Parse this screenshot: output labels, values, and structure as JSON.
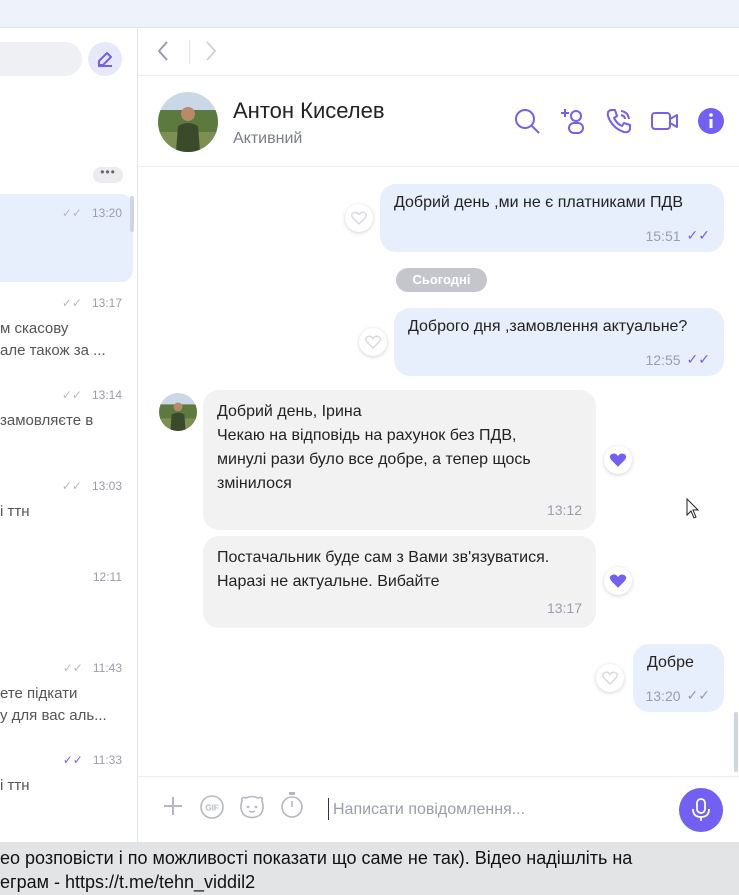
{
  "colors": {
    "accent": "#7360f2",
    "outgoing_bubble": "#e8effc",
    "incoming_bubble": "#f2f2f3",
    "read_check": "#7360f2"
  },
  "left_panel": {
    "more_label": "•••",
    "chats": [
      {
        "time": "13:20",
        "check": "✓✓",
        "line1": "",
        "line2": ""
      },
      {
        "time": "13:17",
        "check": "✓✓",
        "line1": "м скасову",
        "line2": "але також за ..."
      },
      {
        "time": "13:14",
        "check": "✓✓",
        "line1": "замовляєте в",
        "line2": ""
      },
      {
        "time": "13:03",
        "check": "✓✓",
        "line1": "і ттн",
        "line2": ""
      },
      {
        "time": "12:11",
        "check": "",
        "line1": "",
        "line2": ""
      },
      {
        "time": "11:43",
        "check": "✓✓",
        "line1": "ете підкати",
        "line2": "у для вас аль..."
      },
      {
        "time": "11:33",
        "check": "✓✓",
        "line1": "і ттн",
        "line2": ""
      }
    ]
  },
  "header": {
    "name": "Антон Киселев",
    "status": "Активний"
  },
  "messages": {
    "date_chip": "Сьогодні",
    "m1": {
      "text": "Добрий день ,ми не є платниками ПДВ",
      "time": "15:51",
      "check": "✓✓"
    },
    "m2": {
      "text": "Доброго дня ,замовлення актуальне?",
      "time": "12:55",
      "check": "✓✓"
    },
    "m3": {
      "lines": [
        "Добрий день, Ірина",
        "Чекаю на відповідь на рахунок без ПДВ,",
        "минулі рази було все добре, а тепер щось",
        "змінилося"
      ],
      "time": "13:12"
    },
    "m4": {
      "lines": [
        "Постачальник буде сам з Вами зв'язуватися.",
        "Наразі не актуальне. Вибайте"
      ],
      "time": "13:17"
    },
    "m5": {
      "text": "Добре",
      "time": "13:20",
      "check": "✓✓"
    }
  },
  "composer": {
    "placeholder": "Написати повідомлення..."
  },
  "bottom_bar": {
    "line1": "ео розповісти і по можливості показати що саме не так). Відео надішліть на",
    "line2": "еграм  - https://t.me/tehn_viddil2"
  }
}
